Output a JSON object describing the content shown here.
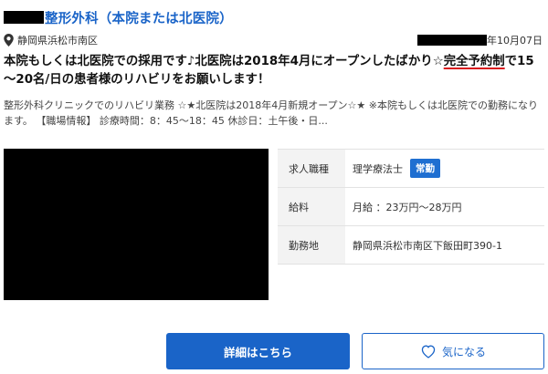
{
  "header": {
    "title": "整形外科（本院または北医院）",
    "location": "静岡県浜松市南区",
    "date": "年10月07日"
  },
  "headline": {
    "before": "本院もしくは北医院での採用です♪北医院は2018年4月にオープンしたばかり☆",
    "highlight": "完全予約制",
    "after": "で15～20名/日の患者様のリハビリをお願いします！"
  },
  "description": "整形外科クリニックでのリハビリ業務 ☆★北医院は2018年4月新規オープン☆★ ※本院もしくは北医院での勤務になります。 【職場情報】 診療時間：8：45～18：45 休診日：土午後・日...",
  "info": {
    "job_label": "求人職種",
    "job_value": "理学療法士",
    "job_badge": "常勤",
    "salary_label": "給料",
    "salary_value": "月給 ：23万円～28万円",
    "location_label": "勤務地",
    "location_value": "静岡県浜松市南区下飯田町390-1"
  },
  "buttons": {
    "detail": "詳細はこちら",
    "favorite": "気になる"
  },
  "colors": {
    "accent": "#1a64c8",
    "highlight_underline": "#d9181e"
  }
}
